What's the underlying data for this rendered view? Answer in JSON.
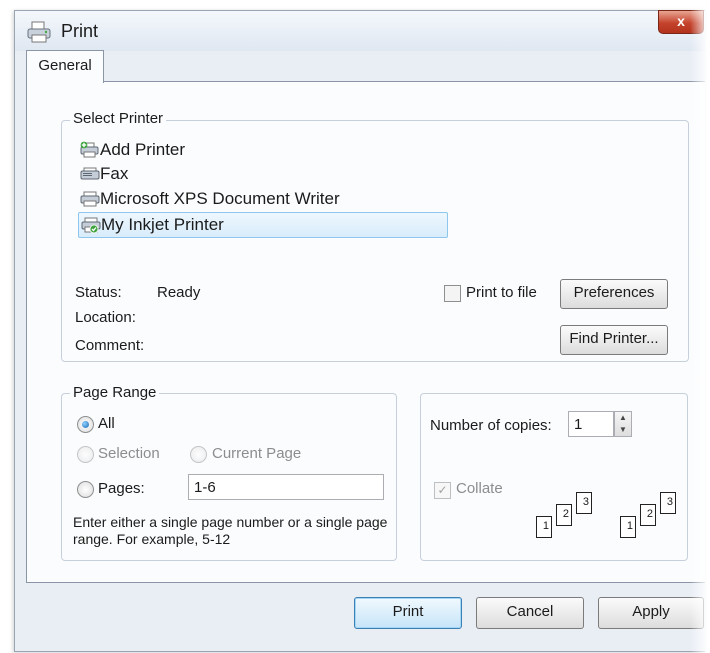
{
  "window": {
    "title": "Print",
    "close_glyph": "x"
  },
  "tabs": [
    {
      "label": "General"
    }
  ],
  "select_printer": {
    "legend": "Select Printer",
    "items": [
      {
        "label": "Add Printer",
        "icon": "add-printer-icon"
      },
      {
        "label": "Fax",
        "icon": "fax-icon"
      },
      {
        "label": "Microsoft XPS Document Writer",
        "icon": "printer-icon"
      },
      {
        "label": "My Inkjet Printer",
        "icon": "inkjet-printer-icon",
        "selected": true
      }
    ],
    "status_label": "Status:",
    "status_value": "Ready",
    "location_label": "Location:",
    "comment_label": "Comment:",
    "print_to_file_label": "Print to file",
    "preferences_label": "Preferences",
    "find_printer_label": "Find Printer..."
  },
  "page_range": {
    "legend": "Page Range",
    "all_label": "All",
    "selection_label": "Selection",
    "current_page_label": "Current Page",
    "pages_label": "Pages:",
    "pages_value": "1-6",
    "hint": "Enter either a single page number or a single page range.  For example, 5-12"
  },
  "copies": {
    "label": "Number of copies:",
    "value": "1",
    "collate_label": "Collate",
    "collate_pages": [
      "1",
      "2",
      "3"
    ]
  },
  "buttons": {
    "print": "Print",
    "cancel": "Cancel",
    "apply": "Apply"
  },
  "colors": {
    "accent": "#3c7fb1",
    "selection": "#d8ecfb",
    "close": "#c5432c"
  }
}
